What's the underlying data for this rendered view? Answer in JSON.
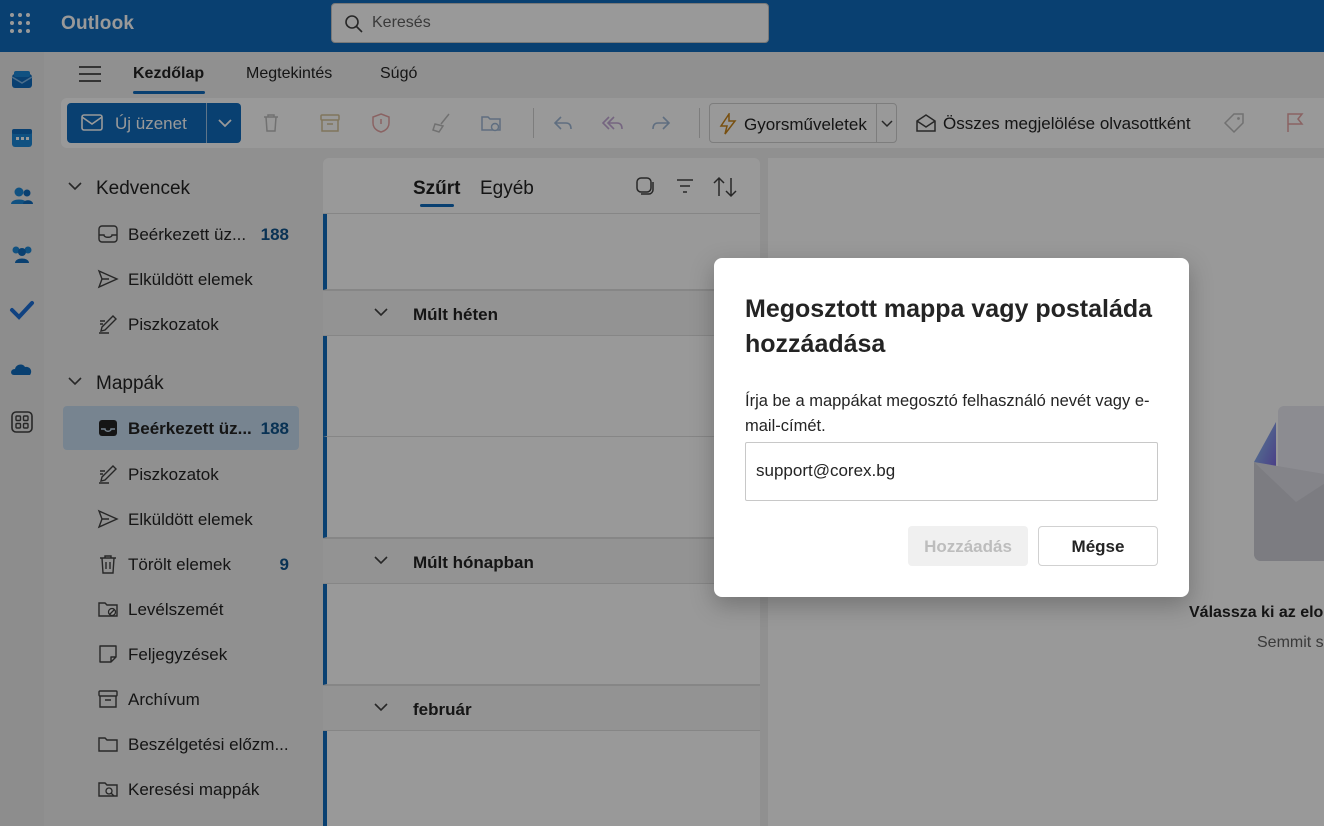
{
  "app": {
    "name": "Outlook"
  },
  "search": {
    "placeholder": "Keresés"
  },
  "tabs": [
    {
      "label": "Kezdőlap",
      "active": true
    },
    {
      "label": "Megtekintés"
    },
    {
      "label": "Súgó"
    }
  ],
  "ribbon": {
    "new_message": "Új üzenet",
    "quick_steps": "Gyorsműveletek",
    "mark_all_read": "Összes megjelölése olvasottként"
  },
  "folders": {
    "favorites_title": "Kedvencek",
    "favorites": [
      {
        "label": "Beérkezett üz...",
        "count": "188",
        "icon": "inbox-icon"
      },
      {
        "label": "Elküldött elemek",
        "icon": "send-icon"
      },
      {
        "label": "Piszkozatok",
        "icon": "draft-icon"
      }
    ],
    "folders_title": "Mappák",
    "items": [
      {
        "label": "Beérkezett üz...",
        "count": "188",
        "icon": "inbox-icon",
        "selected": true
      },
      {
        "label": "Piszkozatok",
        "icon": "draft-icon"
      },
      {
        "label": "Elküldött elemek",
        "icon": "send-icon"
      },
      {
        "label": "Törölt elemek",
        "count": "9",
        "icon": "trash-icon"
      },
      {
        "label": "Levélszemét",
        "icon": "junk-folder-icon"
      },
      {
        "label": "Feljegyzések",
        "icon": "note-icon"
      },
      {
        "label": "Archívum",
        "icon": "archive-icon"
      },
      {
        "label": "Beszélgetési előzm...",
        "icon": "folder-icon"
      },
      {
        "label": "Keresési mappák",
        "icon": "search-folder-icon"
      }
    ]
  },
  "message_list": {
    "tab_focused": "Szűrt",
    "tab_other": "Egyéb",
    "groups": [
      "Múlt héten",
      "Múlt hónapban",
      "február"
    ]
  },
  "reading_pane": {
    "title": "Válassza ki az elo",
    "subtitle": "Semmit s"
  },
  "dialog": {
    "title": "Megosztott mappa vagy postaláda hozzáadása",
    "description": "Írja be a mappákat megosztó felhasználó nevét vagy e-mail-címét.",
    "input_value": "support@corex.bg",
    "add_button": "Hozzáadás",
    "cancel_button": "Mégse"
  }
}
